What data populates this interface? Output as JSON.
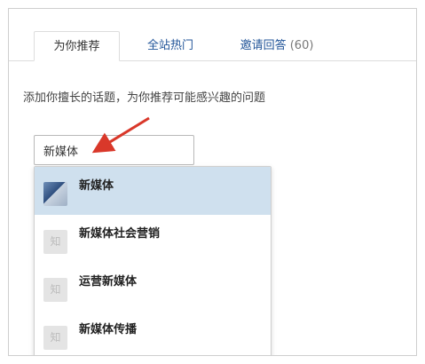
{
  "tabs": [
    {
      "label": "为你推荐"
    },
    {
      "label": "全站热门"
    },
    {
      "label": "邀请回答",
      "count": "(60)"
    }
  ],
  "hint": "添加你擅长的话题，为你推荐可能感兴趣的问题",
  "search": {
    "value": "新媒体"
  },
  "suggestions": [
    {
      "label": "新媒体",
      "thumb": ""
    },
    {
      "label": "新媒体社会营销",
      "thumb": "知"
    },
    {
      "label": "运营新媒体",
      "thumb": "知"
    },
    {
      "label": "新媒体传播",
      "thumb": "知"
    }
  ],
  "colors": {
    "accent": "#225599",
    "selected_bg": "#cfe0ee",
    "arrow": "#d9382a"
  }
}
